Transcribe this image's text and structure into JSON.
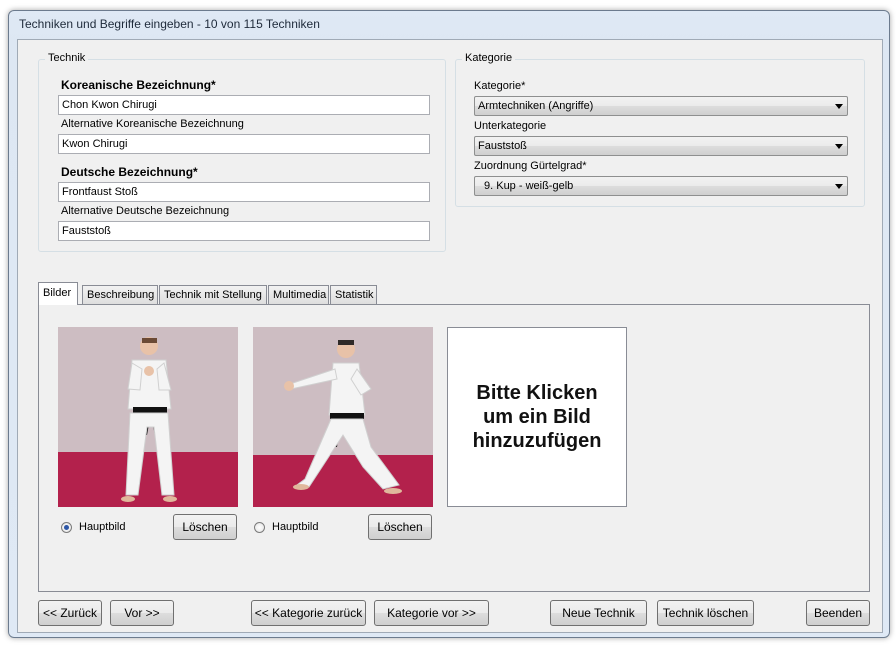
{
  "window": {
    "title": "Techniken und Begriffe eingeben - 10 von 115 Techniken"
  },
  "technik": {
    "legend": "Technik",
    "korean_label": "Koreanische Bezeichnung*",
    "korean_value": "Chon Kwon Chirugi",
    "alt_korean_label": "Alternative Koreanische Bezeichnung",
    "alt_korean_value": "Kwon Chirugi",
    "german_label": "Deutsche Bezeichnung*",
    "german_value": "Frontfaust Stoß",
    "alt_german_label": "Alternative Deutsche Bezeichnung",
    "alt_german_value": "Fauststoß"
  },
  "kategorie": {
    "legend": "Kategorie",
    "kategorie_label": "Kategorie*",
    "kategorie_value": "Armtechniken (Angriffe)",
    "unterkategorie_label": "Unterkategorie",
    "unterkategorie_value": "Fauststoß",
    "guertel_label": "Zuordnung Gürtelgrad*",
    "guertel_value": "9. Kup - weiß-gelb"
  },
  "tabs": [
    {
      "label": "Bilder"
    },
    {
      "label": "Beschreibung"
    },
    {
      "label": "Technik mit Stellung"
    },
    {
      "label": "Multimedia"
    },
    {
      "label": "Statistik"
    }
  ],
  "bilder": {
    "image1": {
      "radio_label": "Hauptbild",
      "delete_label": "Löschen",
      "selected": true
    },
    "image2": {
      "radio_label": "Hauptbild",
      "delete_label": "Löschen",
      "selected": false
    },
    "placeholder_text": "Bitte Klicken um ein Bild hinzuzufügen"
  },
  "footer": {
    "back_label": "<< Zurück",
    "next_label": "Vor >>",
    "cat_back_label": "<< Kategorie zurück",
    "cat_next_label": "Kategorie vor >>",
    "new_label": "Neue Technik",
    "delete_label": "Technik löschen",
    "quit_label": "Beenden"
  }
}
